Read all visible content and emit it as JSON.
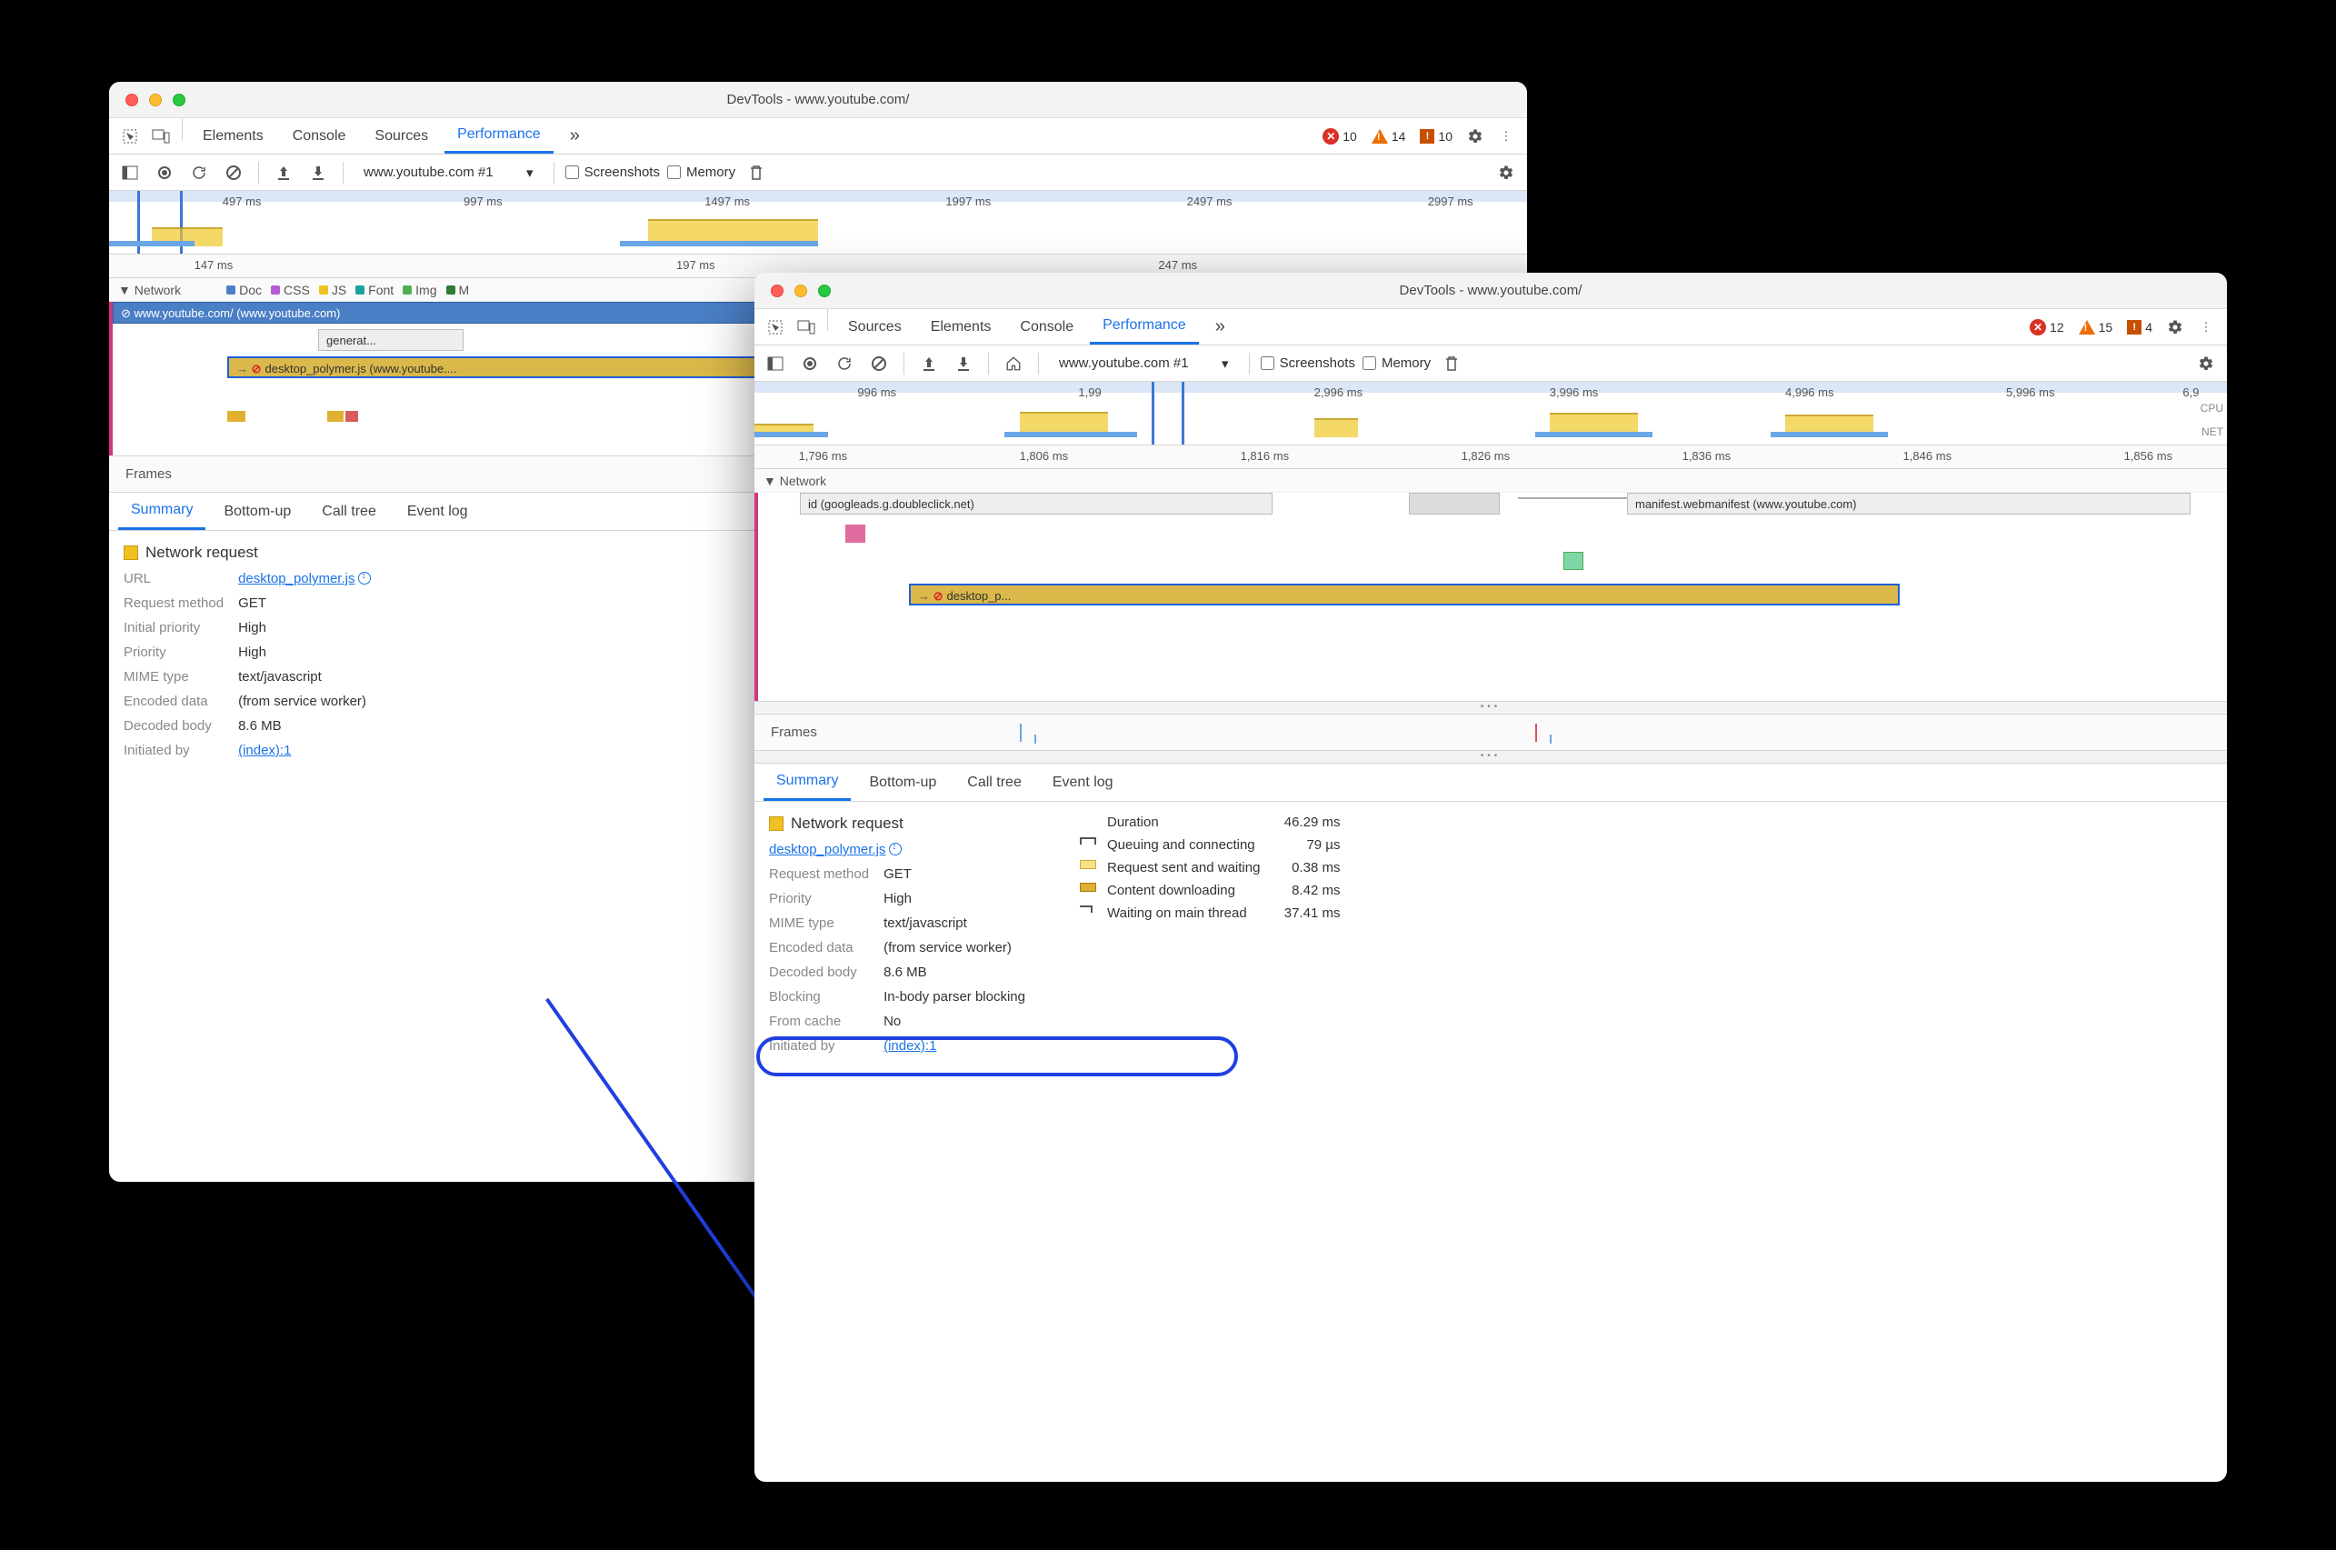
{
  "windowA": {
    "title": "DevTools - www.youtube.com/",
    "tabs": [
      "Elements",
      "Console",
      "Sources",
      "Performance"
    ],
    "active_tab": "Performance",
    "badges": {
      "errors": "10",
      "warnings": "14",
      "issues": "10"
    },
    "dropdown": "www.youtube.com #1",
    "checkboxes": {
      "screenshots": "Screenshots",
      "memory": "Memory"
    },
    "overview_ticks": [
      "497 ms",
      "997 ms",
      "1497 ms",
      "1997 ms",
      "2497 ms",
      "2997 ms"
    ],
    "ruler_ticks": [
      "147 ms",
      "197 ms",
      "247 ms"
    ],
    "lane_label": "Network",
    "legend": [
      {
        "label": "Doc",
        "color": "#4a7fc6"
      },
      {
        "label": "CSS",
        "color": "#b55bd3"
      },
      {
        "label": "JS",
        "color": "#f0c020"
      },
      {
        "label": "Font",
        "color": "#1aa39a"
      },
      {
        "label": "Img",
        "color": "#4caf50"
      },
      {
        "label": "M",
        "color": "#2e7d32"
      }
    ],
    "net_rows": {
      "main": "www.youtube.com/ (www.youtube.com)",
      "second": "generat...",
      "third": "desktop_polymer.js (www.youtube...."
    },
    "frames_label": "Frames",
    "subtabs": [
      "Summary",
      "Bottom-up",
      "Call tree",
      "Event log"
    ],
    "active_subtab": "Summary",
    "details": {
      "heading": "Network request",
      "URL_label": "URL",
      "URL_value": "desktop_polymer.js",
      "Request_method_label": "Request method",
      "Request_method_value": "GET",
      "Initial_priority_label": "Initial priority",
      "Initial_priority_value": "High",
      "Priority_label": "Priority",
      "Priority_value": "High",
      "MIME_type_label": "MIME type",
      "MIME_type_value": "text/javascript",
      "Encoded_data_label": "Encoded data",
      "Encoded_data_value": "(from service worker)",
      "Decoded_body_label": "Decoded body",
      "Decoded_body_value": "8.6 MB",
      "Initiated_by_label": "Initiated by",
      "Initiated_by_value": "(index):1"
    }
  },
  "windowB": {
    "title": "DevTools - www.youtube.com/",
    "tabs": [
      "Sources",
      "Elements",
      "Console",
      "Performance"
    ],
    "active_tab": "Performance",
    "badges": {
      "errors": "12",
      "warnings": "15",
      "issues": "4"
    },
    "dropdown": "www.youtube.com #1",
    "checkboxes": {
      "screenshots": "Screenshots",
      "memory": "Memory"
    },
    "overview_ticks": [
      "996 ms",
      "1,99",
      "2,996 ms",
      "3,996 ms",
      "4,996 ms",
      "5,996 ms",
      "6,9"
    ],
    "overview_right": {
      "cpu": "CPU",
      "net": "NET"
    },
    "ruler_ticks": [
      "1,796 ms",
      "1,806 ms",
      "1,816 ms",
      "1,826 ms",
      "1,836 ms",
      "1,846 ms",
      "1,856 ms"
    ],
    "lane_label": "Network",
    "net_rows": {
      "left": "id (googleads.g.doubleclick.net)",
      "right": "manifest.webmanifest (www.youtube.com)",
      "target": "desktop_p..."
    },
    "frames_label": "Frames",
    "subtabs": [
      "Summary",
      "Bottom-up",
      "Call tree",
      "Event log"
    ],
    "active_subtab": "Summary",
    "details": {
      "heading": "Network request",
      "URL_value": "desktop_polymer.js",
      "Request_method_label": "Request method",
      "Request_method_value": "GET",
      "Priority_label": "Priority",
      "Priority_value": "High",
      "MIME_type_label": "MIME type",
      "MIME_type_value": "text/javascript",
      "Encoded_data_label": "Encoded data",
      "Encoded_data_value": "(from service worker)",
      "Decoded_body_label": "Decoded body",
      "Decoded_body_value": "8.6 MB",
      "Blocking_label": "Blocking",
      "Blocking_value": "In-body parser blocking",
      "From_cache_label": "From cache",
      "From_cache_value": "No",
      "Initiated_by_label": "Initiated by",
      "Initiated_by_value": "(index):1"
    },
    "timing": {
      "Duration_label": "Duration",
      "Duration_value": "46.29 ms",
      "Queuing_label": "Queuing and connecting",
      "Queuing_value": "79 µs",
      "Sent_label": "Request sent and waiting",
      "Sent_value": "0.38 ms",
      "Download_label": "Content downloading",
      "Download_value": "8.42 ms",
      "Waiting_label": "Waiting on main thread",
      "Waiting_value": "37.41 ms"
    }
  }
}
